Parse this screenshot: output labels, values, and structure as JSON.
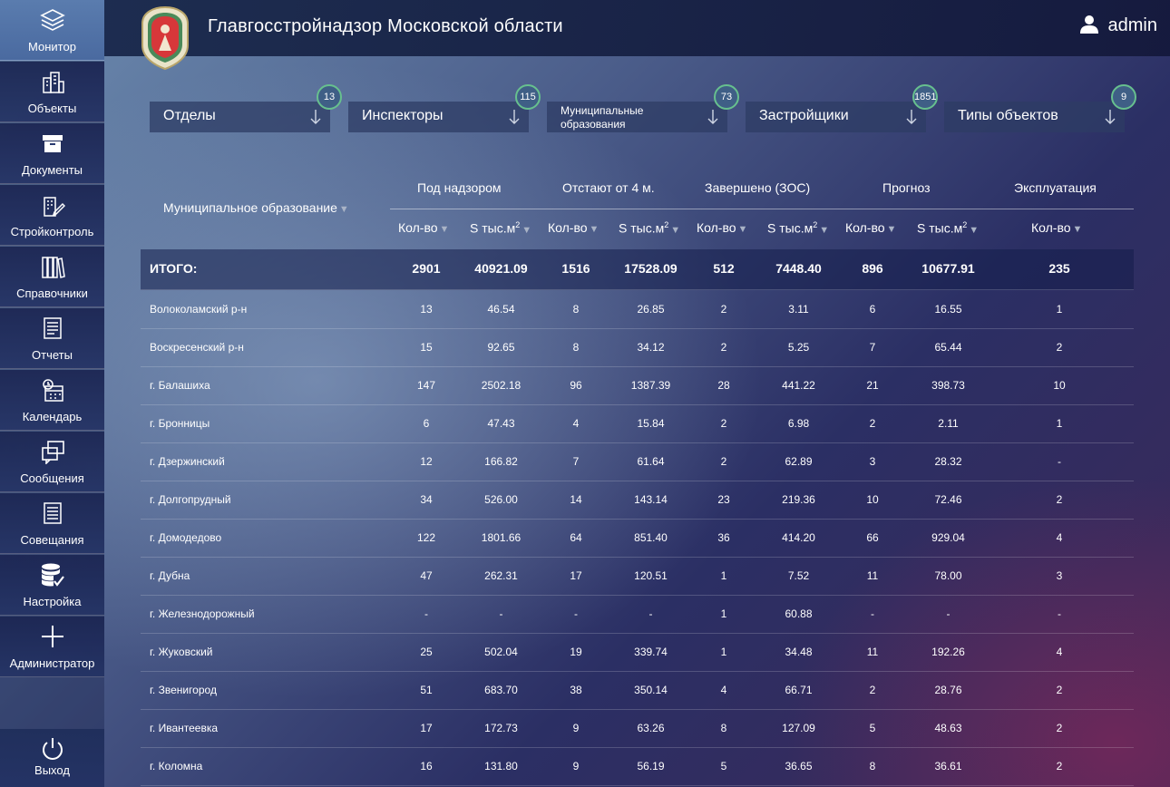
{
  "app": {
    "title": "Главгосстройнадзор Московской области",
    "user": "admin"
  },
  "sidebar": {
    "items": [
      {
        "label": "Монитор",
        "icon": "layers-icon"
      },
      {
        "label": "Объекты",
        "icon": "buildings-icon"
      },
      {
        "label": "Документы",
        "icon": "archive-box-icon"
      },
      {
        "label": "Стройконтроль",
        "icon": "building-edit-icon"
      },
      {
        "label": "Справочники",
        "icon": "books-icon"
      },
      {
        "label": "Отчеты",
        "icon": "report-list-icon"
      },
      {
        "label": "Календарь",
        "icon": "calendar-clock-icon"
      },
      {
        "label": "Сообщения",
        "icon": "messages-icon"
      },
      {
        "label": "Совещания",
        "icon": "meeting-list-icon"
      },
      {
        "label": "Настройка",
        "icon": "database-check-icon"
      },
      {
        "label": "Администратор",
        "icon": "plus-icon"
      }
    ],
    "exit_label": "Выход"
  },
  "filters": [
    {
      "label": "Отделы",
      "count": "13"
    },
    {
      "label": "Инспекторы",
      "count": "115"
    },
    {
      "label": "Муниципальные образования",
      "count": "73"
    },
    {
      "label": "Застройщики",
      "count": "1851"
    },
    {
      "label": "Типы объектов",
      "count": "9"
    }
  ],
  "table": {
    "municipality_header": "Муниципальное образование",
    "groups": [
      "Под надзором",
      "Отстают от 4 м.",
      "Завершено (ЗОС)",
      "Прогноз",
      "Эксплуатация"
    ],
    "sub_count": "Кол-во",
    "sub_area": "S тыс.м",
    "sub_area_sup": "2",
    "total": {
      "name": "ИТОГО:",
      "values": [
        "2901",
        "40921.09",
        "1516",
        "17528.09",
        "512",
        "7448.40",
        "896",
        "10677.91",
        "235"
      ]
    },
    "rows": [
      {
        "name": "Волоколамский р-н",
        "values": [
          "13",
          "46.54",
          "8",
          "26.85",
          "2",
          "3.11",
          "6",
          "16.55",
          "1"
        ]
      },
      {
        "name": "Воскресенский р-н",
        "values": [
          "15",
          "92.65",
          "8",
          "34.12",
          "2",
          "5.25",
          "7",
          "65.44",
          "2"
        ]
      },
      {
        "name": "г. Балашиха",
        "values": [
          "147",
          "2502.18",
          "96",
          "1387.39",
          "28",
          "441.22",
          "21",
          "398.73",
          "10"
        ]
      },
      {
        "name": "г. Бронницы",
        "values": [
          "6",
          "47.43",
          "4",
          "15.84",
          "2",
          "6.98",
          "2",
          "2.11",
          "1"
        ]
      },
      {
        "name": "г. Дзержинский",
        "values": [
          "12",
          "166.82",
          "7",
          "61.64",
          "2",
          "62.89",
          "3",
          "28.32",
          "-"
        ]
      },
      {
        "name": "г. Долгопрудный",
        "values": [
          "34",
          "526.00",
          "14",
          "143.14",
          "23",
          "219.36",
          "10",
          "72.46",
          "2"
        ]
      },
      {
        "name": "г. Домодедово",
        "values": [
          "122",
          "1801.66",
          "64",
          "851.40",
          "36",
          "414.20",
          "66",
          "929.04",
          "4"
        ]
      },
      {
        "name": "г. Дубна",
        "values": [
          "47",
          "262.31",
          "17",
          "120.51",
          "1",
          "7.52",
          "11",
          "78.00",
          "3"
        ]
      },
      {
        "name": "г. Железнодорожный",
        "values": [
          "-",
          "-",
          "-",
          "-",
          "1",
          "60.88",
          "-",
          "-",
          "-"
        ]
      },
      {
        "name": "г. Жуковский",
        "values": [
          "25",
          "502.04",
          "19",
          "339.74",
          "1",
          "34.48",
          "11",
          "192.26",
          "4"
        ]
      },
      {
        "name": "г. Звенигород",
        "values": [
          "51",
          "683.70",
          "38",
          "350.14",
          "4",
          "66.71",
          "2",
          "28.76",
          "2"
        ]
      },
      {
        "name": "г. Ивантеевка",
        "values": [
          "17",
          "172.73",
          "9",
          "63.26",
          "8",
          "127.09",
          "5",
          "48.63",
          "2"
        ]
      },
      {
        "name": "г. Коломна",
        "values": [
          "16",
          "131.80",
          "9",
          "56.19",
          "5",
          "36.65",
          "8",
          "36.61",
          "2"
        ]
      }
    ]
  }
}
